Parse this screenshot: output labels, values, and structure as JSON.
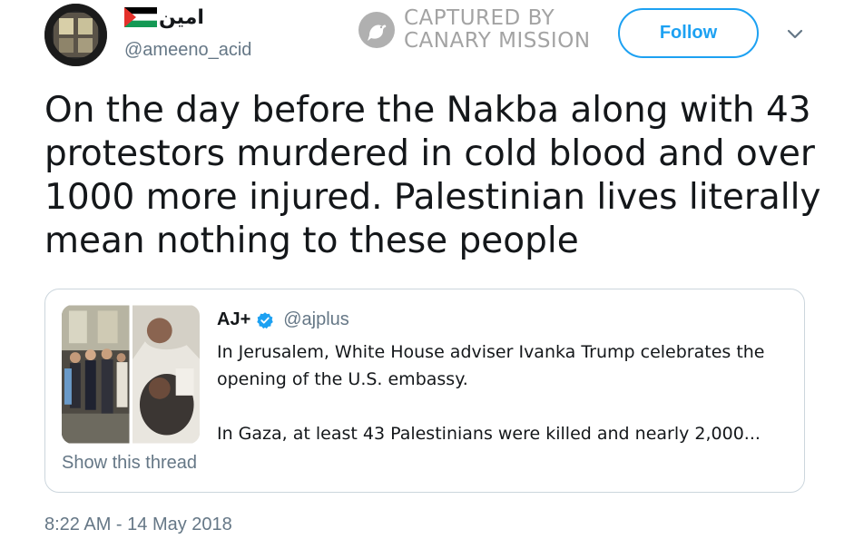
{
  "author": {
    "display_name": "امين",
    "handle": "@ameeno_acid",
    "flag_icon": "palestine-flag-icon"
  },
  "watermark": {
    "line1": "CAPTURED BY",
    "line2": "CANARY MISSION"
  },
  "actions": {
    "follow_label": "Follow"
  },
  "tweet": {
    "text": "On the day before the Nakba along with 43 protestors murdered in cold blood and over 1000 more injured. Palestinian lives literally mean nothing to these people",
    "timestamp": "8:22 AM - 14 May 2018"
  },
  "quoted_tweet": {
    "name": "AJ+",
    "handle": "@ajplus",
    "verified": true,
    "paragraph1": "In Jerusalem, White House adviser Ivanka Trump celebrates the opening of the U.S. embassy.",
    "paragraph2": "In Gaza, at least 43 Palestinians were killed and nearly 2,000...",
    "show_thread_label": "Show this thread"
  },
  "colors": {
    "accent": "#1da1f2",
    "secondary_text": "#657786",
    "border": "#ccd6dd"
  }
}
